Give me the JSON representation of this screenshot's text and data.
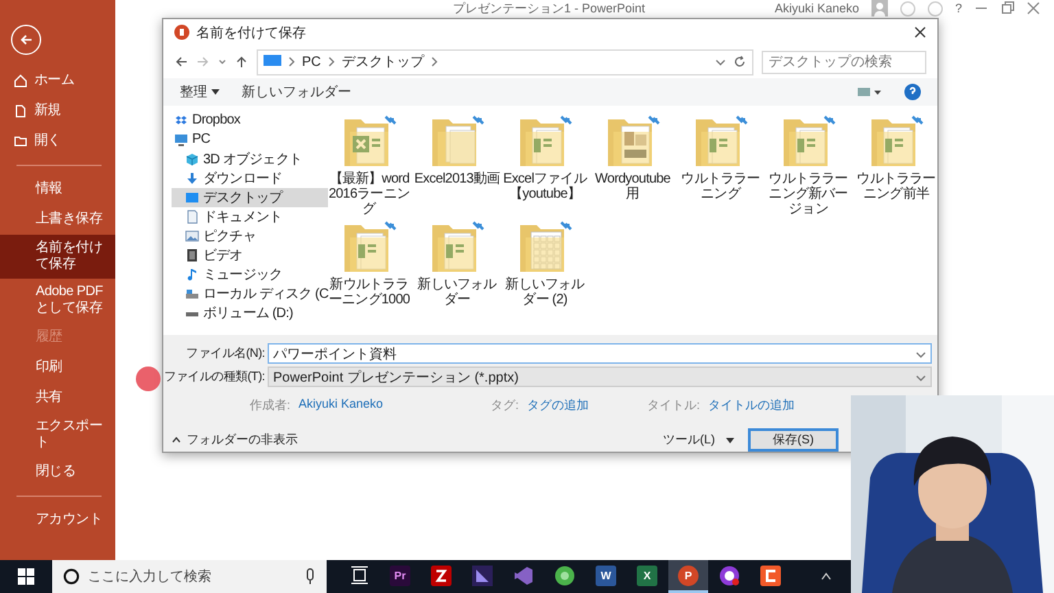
{
  "app_window": {
    "title": "プレゼンテーション1 - PowerPoint",
    "user": "Akiyuki Kaneko",
    "help": "?"
  },
  "sidebar": [
    {
      "kind": "back"
    },
    {
      "kind": "icon-item",
      "label": "ホーム",
      "selected": false,
      "disabled": false
    },
    {
      "kind": "icon-item",
      "label": "新規",
      "selected": false,
      "disabled": false
    },
    {
      "kind": "icon-item",
      "label": "開く",
      "selected": false,
      "disabled": false
    },
    {
      "kind": "divider"
    },
    {
      "kind": "item",
      "label": "情報",
      "selected": false,
      "disabled": false
    },
    {
      "kind": "item",
      "label": "上書き保存",
      "selected": false,
      "disabled": false
    },
    {
      "kind": "item",
      "label": "名前を付けて保存",
      "selected": true,
      "disabled": false
    },
    {
      "kind": "item",
      "label": "Adobe PDF として保存",
      "selected": false,
      "disabled": false
    },
    {
      "kind": "item",
      "label": "履歴",
      "selected": false,
      "disabled": true
    },
    {
      "kind": "item",
      "label": "印刷",
      "selected": false,
      "disabled": false
    },
    {
      "kind": "item",
      "label": "共有",
      "selected": false,
      "disabled": false
    },
    {
      "kind": "item",
      "label": "エクスポート",
      "selected": false,
      "disabled": false
    },
    {
      "kind": "item",
      "label": "閉じる",
      "selected": false,
      "disabled": false
    },
    {
      "kind": "divider"
    },
    {
      "kind": "item",
      "label": "アカウント",
      "selected": false,
      "disabled": false
    }
  ],
  "dialog": {
    "title": "名前を付けて保存",
    "path": [
      "PC",
      "デスクトップ"
    ],
    "search_placeholder": "デスクトップの検索",
    "toolbar": {
      "organize": "整理",
      "new_folder": "新しいフォルダー"
    },
    "nav": [
      {
        "label": "Dropbox",
        "selected": false
      },
      {
        "label": "PC",
        "selected": false
      },
      {
        "label": "3D オブジェクト",
        "selected": false
      },
      {
        "label": "ダウンロード",
        "selected": false
      },
      {
        "label": "デスクトップ",
        "selected": true
      },
      {
        "label": "ドキュメント",
        "selected": false
      },
      {
        "label": "ピクチャ",
        "selected": false
      },
      {
        "label": "ビデオ",
        "selected": false
      },
      {
        "label": "ミュージック",
        "selected": false
      },
      {
        "label": "ローカル ディスク (C",
        "selected": false
      },
      {
        "label": "ボリューム (D:)",
        "selected": false
      }
    ],
    "files": [
      {
        "name": "【最新】word2016ラーニング",
        "kind": "excel"
      },
      {
        "name": "Excel2013動画",
        "kind": "blank"
      },
      {
        "name": "Excelファイル【youtube】",
        "kind": "sheets"
      },
      {
        "name": "Wordyoutube用"
      },
      {
        "name": "ウルトララーニング",
        "kind": "sheets"
      },
      {
        "name": "ウルトララーニング新バージョン",
        "kind": "sheets"
      },
      {
        "name": "ウルトララーニング前半",
        "kind": "sheets"
      },
      {
        "name": "新ウルトララーニング1000",
        "kind": "sheets"
      },
      {
        "name": "新しいフォルダー",
        "kind": "sheets"
      },
      {
        "name": "新しいフォルダー (2)",
        "kind": "keyboard"
      }
    ],
    "file_name_label": "ファイル名(N):",
    "file_name": "パワーポイント資料",
    "file_type_label": "ファイルの種類(T):",
    "file_type": "PowerPoint プレゼンテーション (*.pptx)",
    "meta": [
      {
        "label": "作成者:",
        "value": "Akiyuki Kaneko"
      },
      {
        "label": "タグ:",
        "value": "タグの追加"
      },
      {
        "label": "タイトル:",
        "value": "タイトルの追加"
      }
    ],
    "hide_folders": "フォルダーの非表示",
    "tools": "ツール(L)",
    "save": "保存(S)"
  },
  "taskbar": {
    "search_placeholder": "ここに入力して検索",
    "apps": [
      {
        "kind": "taskview",
        "selected": false
      },
      {
        "kind": "premiere",
        "label": "Pr",
        "selected": false
      },
      {
        "kind": "filezilla",
        "selected": false
      },
      {
        "kind": "purple",
        "selected": false
      },
      {
        "kind": "studio",
        "selected": false
      },
      {
        "kind": "green",
        "selected": false
      },
      {
        "kind": "word",
        "label": "W",
        "selected": false
      },
      {
        "kind": "excel",
        "label": "X",
        "selected": false
      },
      {
        "kind": "powerpoint",
        "label": "P",
        "selected": true
      },
      {
        "kind": "recorder",
        "selected": false
      },
      {
        "kind": "orange",
        "selected": false
      }
    ]
  }
}
